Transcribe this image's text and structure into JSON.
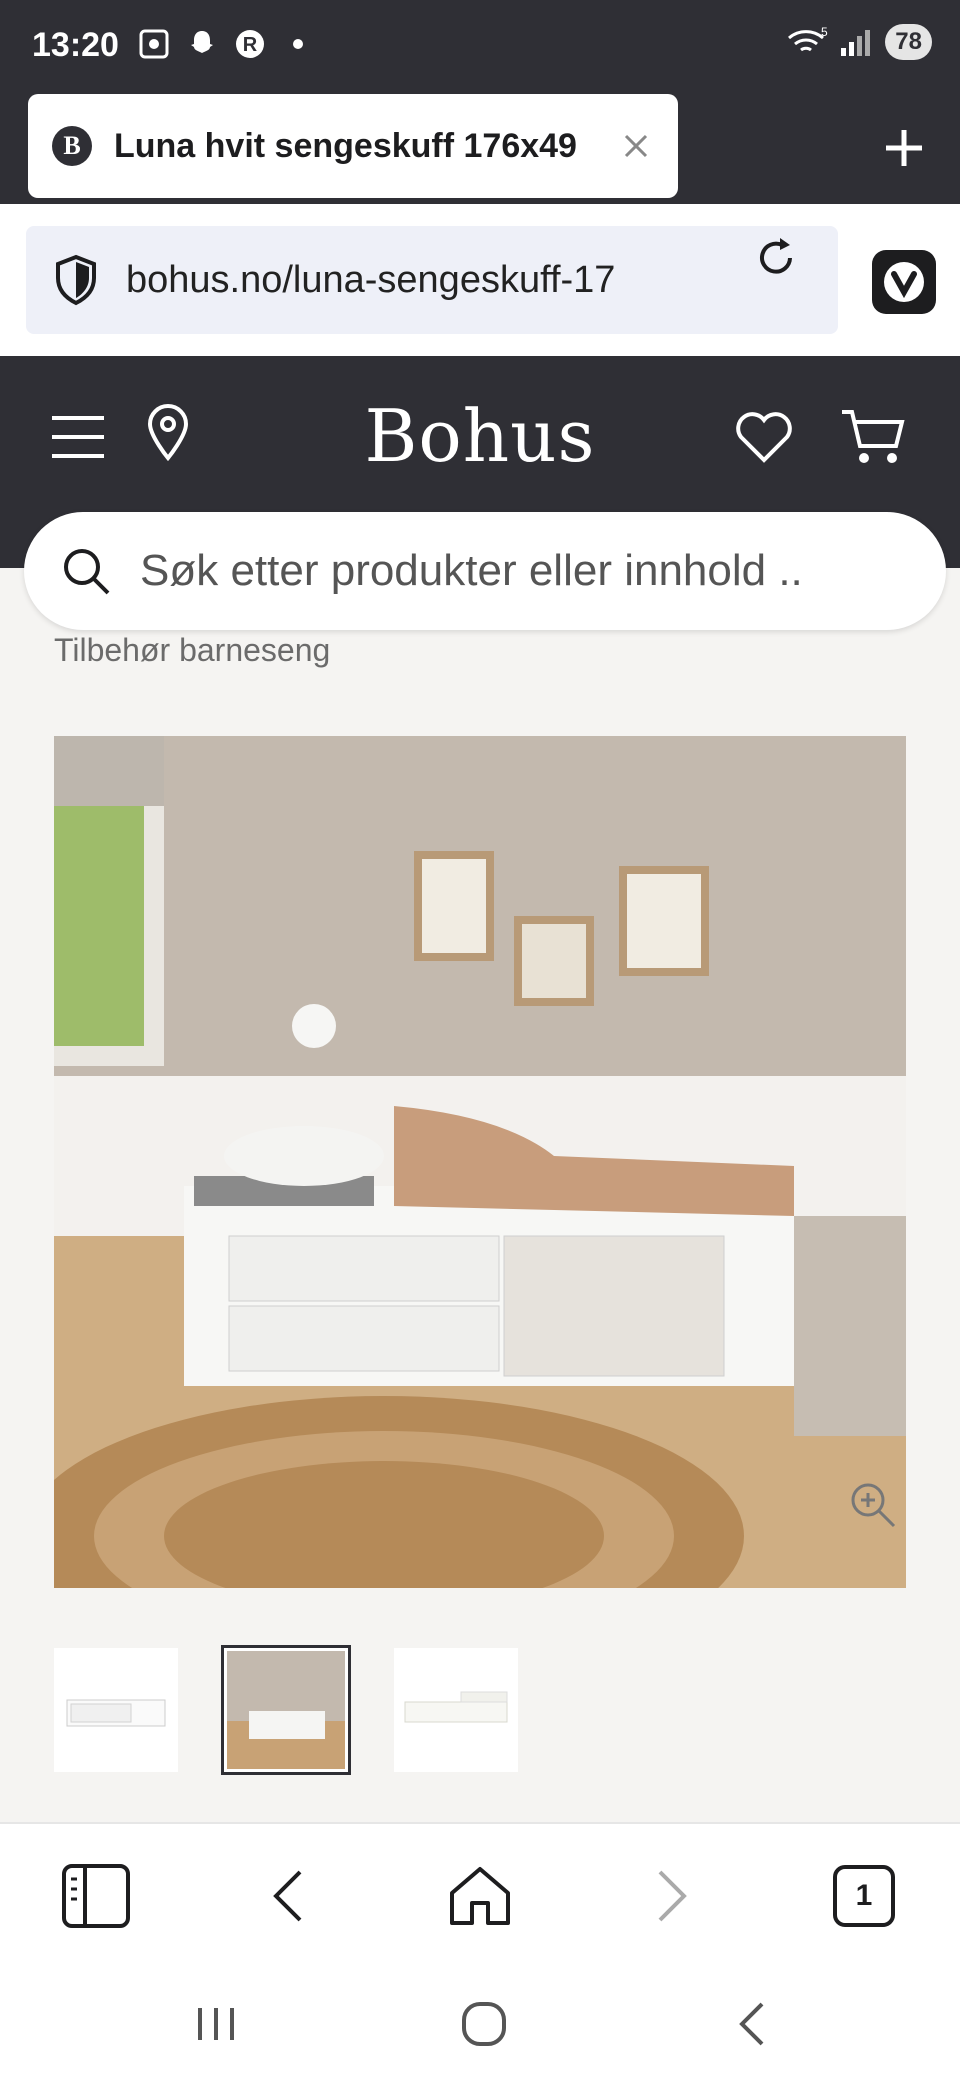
{
  "status_bar": {
    "time": "13:20",
    "battery": "78",
    "wifi_badge": "5"
  },
  "tab": {
    "favicon": "B",
    "title": "Luna hvit sengeskuff 176x49"
  },
  "address_bar": {
    "url": "bohus.no/luna-sengeskuff-17"
  },
  "site": {
    "logo": "Bohus",
    "search_placeholder": "Søk etter produkter eller innhold ..",
    "breadcrumb": "Tilbehør barneseng"
  },
  "bottom_bar": {
    "tab_count": "1"
  },
  "colors": {
    "header_bg": "#2f2f35",
    "page_bg": "#f5f4f2"
  },
  "icons": [
    "menu-icon",
    "location-icon",
    "heart-icon",
    "cart-icon",
    "search-icon",
    "zoom-icon",
    "close-icon",
    "plus-icon",
    "reload-icon",
    "shield-icon",
    "sidebar-icon",
    "back-icon",
    "home-icon",
    "forward-icon"
  ]
}
